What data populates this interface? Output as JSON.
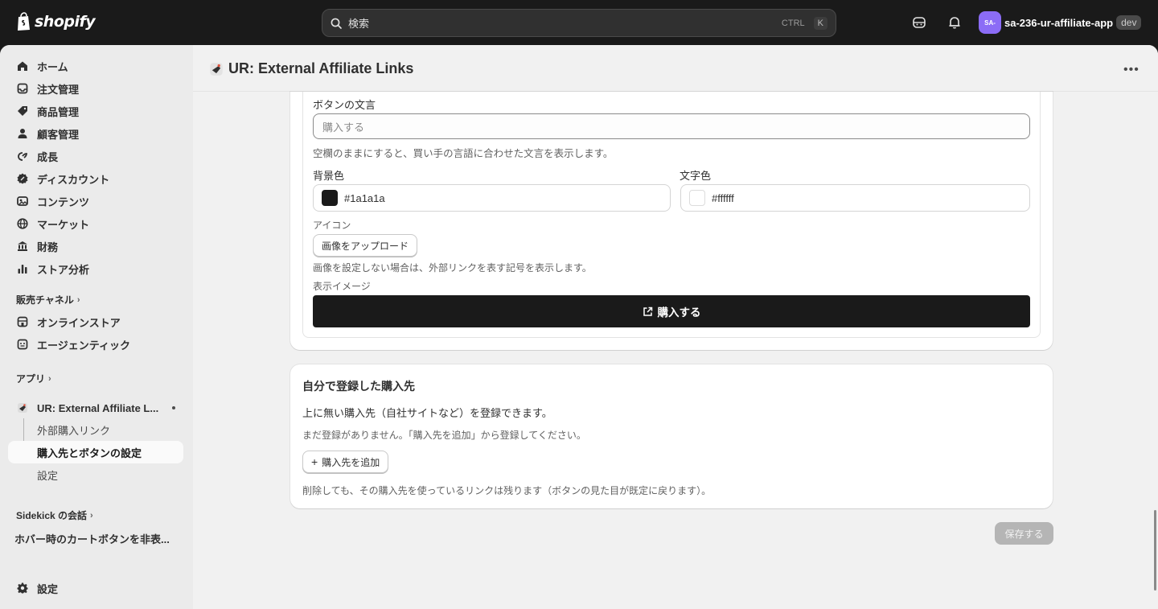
{
  "topbar": {
    "logo_text": "shopify",
    "search_placeholder": "検索",
    "kbd_ctrl": "CTRL",
    "kbd_k": "K",
    "store_initials": "SA-",
    "store_name": "sa-236-ur-affiliate-app",
    "dev_badge": "dev"
  },
  "sidebar": {
    "items": [
      {
        "label": "ホーム",
        "icon": "home-icon"
      },
      {
        "label": "注文管理",
        "icon": "inbox-icon"
      },
      {
        "label": "商品管理",
        "icon": "tag-icon"
      },
      {
        "label": "顧客管理",
        "icon": "person-icon"
      },
      {
        "label": "成長",
        "icon": "growth-icon"
      },
      {
        "label": "ディスカウント",
        "icon": "discount-icon"
      },
      {
        "label": "コンテンツ",
        "icon": "content-icon"
      },
      {
        "label": "マーケット",
        "icon": "globe-icon"
      },
      {
        "label": "財務",
        "icon": "bank-icon"
      },
      {
        "label": "ストア分析",
        "icon": "chart-icon"
      }
    ],
    "sales_channels_label": "販売チャネル",
    "channels": [
      {
        "label": "オンラインストア",
        "icon": "store-icon"
      },
      {
        "label": "エージェンティック",
        "icon": "agent-icon"
      }
    ],
    "apps_label": "アプリ",
    "app_name": "UR: External Affiliate L...",
    "app_subitems": [
      "外部購入リンク",
      "購入先とボタンの設定",
      "設定"
    ],
    "sidekick_label": "Sidekick の会話",
    "sidekick_conversation": "ホバー時のカートボタンを非表...",
    "settings_label": "設定"
  },
  "page": {
    "title": "UR: External Affiliate Links"
  },
  "button_settings": {
    "button_text_label": "ボタンの文言",
    "button_text_placeholder": "購入する",
    "button_text_help": "空欄のままにすると、買い手の言語に合わせた文言を表示します。",
    "bg_color_label": "背景色",
    "bg_color_value": "#1a1a1a",
    "text_color_label": "文字色",
    "text_color_value": "#ffffff",
    "icon_label": "アイコン",
    "upload_button": "画像をアップロード",
    "icon_help": "画像を設定しない場合は、外部リンクを表す記号を表示します。",
    "preview_label": "表示イメージ",
    "preview_button_text": "購入する"
  },
  "custom_destinations": {
    "title": "自分で登録した購入先",
    "description": "上に無い購入先（自社サイトなど）を登録できます。",
    "empty_text": "まだ登録がありません。「購入先を追加」から登録してください。",
    "add_button": "購入先を追加",
    "footnote": "削除しても、その購入先を使っているリンクは残ります（ボタンの見た目が既定に戻ります）。"
  },
  "save_button": "保存する",
  "colors": {
    "topbar_bg": "#1a1a1a",
    "accent_avatar": "#8b6cf6",
    "preview_bg": "#1a1a1a",
    "preview_text": "#ffffff"
  }
}
